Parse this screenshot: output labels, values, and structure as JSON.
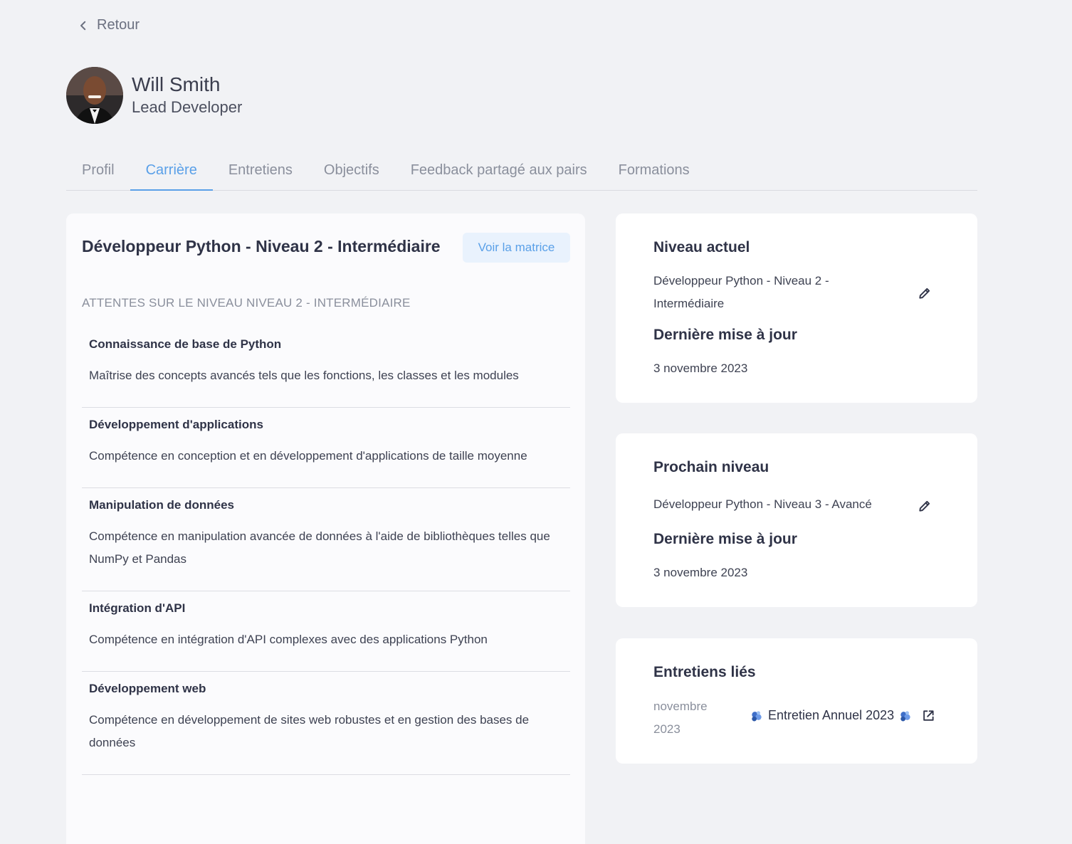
{
  "nav": {
    "back_label": "Retour"
  },
  "profile": {
    "name": "Will Smith",
    "role": "Lead Developer"
  },
  "tabs": [
    {
      "label": "Profil"
    },
    {
      "label": "Carrière"
    },
    {
      "label": "Entretiens"
    },
    {
      "label": "Objectifs"
    },
    {
      "label": "Feedback partagé aux pairs"
    },
    {
      "label": "Formations"
    }
  ],
  "career": {
    "title": "Développeur Python - Niveau 2 - Intermédiaire",
    "matrix_button": "Voir la matrice",
    "section_label": "ATTENTES SUR LE NIVEAU NIVEAU 2 - INTERMÉDIAIRE",
    "items": [
      {
        "title": "Connaissance de base de Python",
        "desc": "Maîtrise des concepts avancés tels que les fonctions, les classes et les modules"
      },
      {
        "title": "Développement d'applications",
        "desc": "Compétence en conception et en développement d'applications de taille moyenne"
      },
      {
        "title": "Manipulation de données",
        "desc": "Compétence en manipulation avancée de données à l'aide de bibliothèques telles que NumPy et Pandas"
      },
      {
        "title": "Intégration d'API",
        "desc": "Compétence en intégration d'API complexes avec des applications Python"
      },
      {
        "title": "Développement web",
        "desc": "Compétence en développement de sites web robustes et en gestion des bases de données"
      }
    ]
  },
  "current_level": {
    "title": "Niveau actuel",
    "value_line1": "Développeur Python - Niveau 2 -",
    "value_line2": "Intermédiaire",
    "updated_label": "Dernière mise à jour",
    "updated_date": "3 novembre 2023"
  },
  "next_level": {
    "title": "Prochain niveau",
    "value": "Développeur Python - Niveau 3 - Avancé",
    "updated_label": "Dernière mise à jour",
    "updated_date": "3 novembre 2023"
  },
  "linked_interviews": {
    "title": "Entretiens liés",
    "date_line1": "novembre",
    "date_line2": "2023",
    "interview_name": "Entretien Annuel 2023"
  }
}
